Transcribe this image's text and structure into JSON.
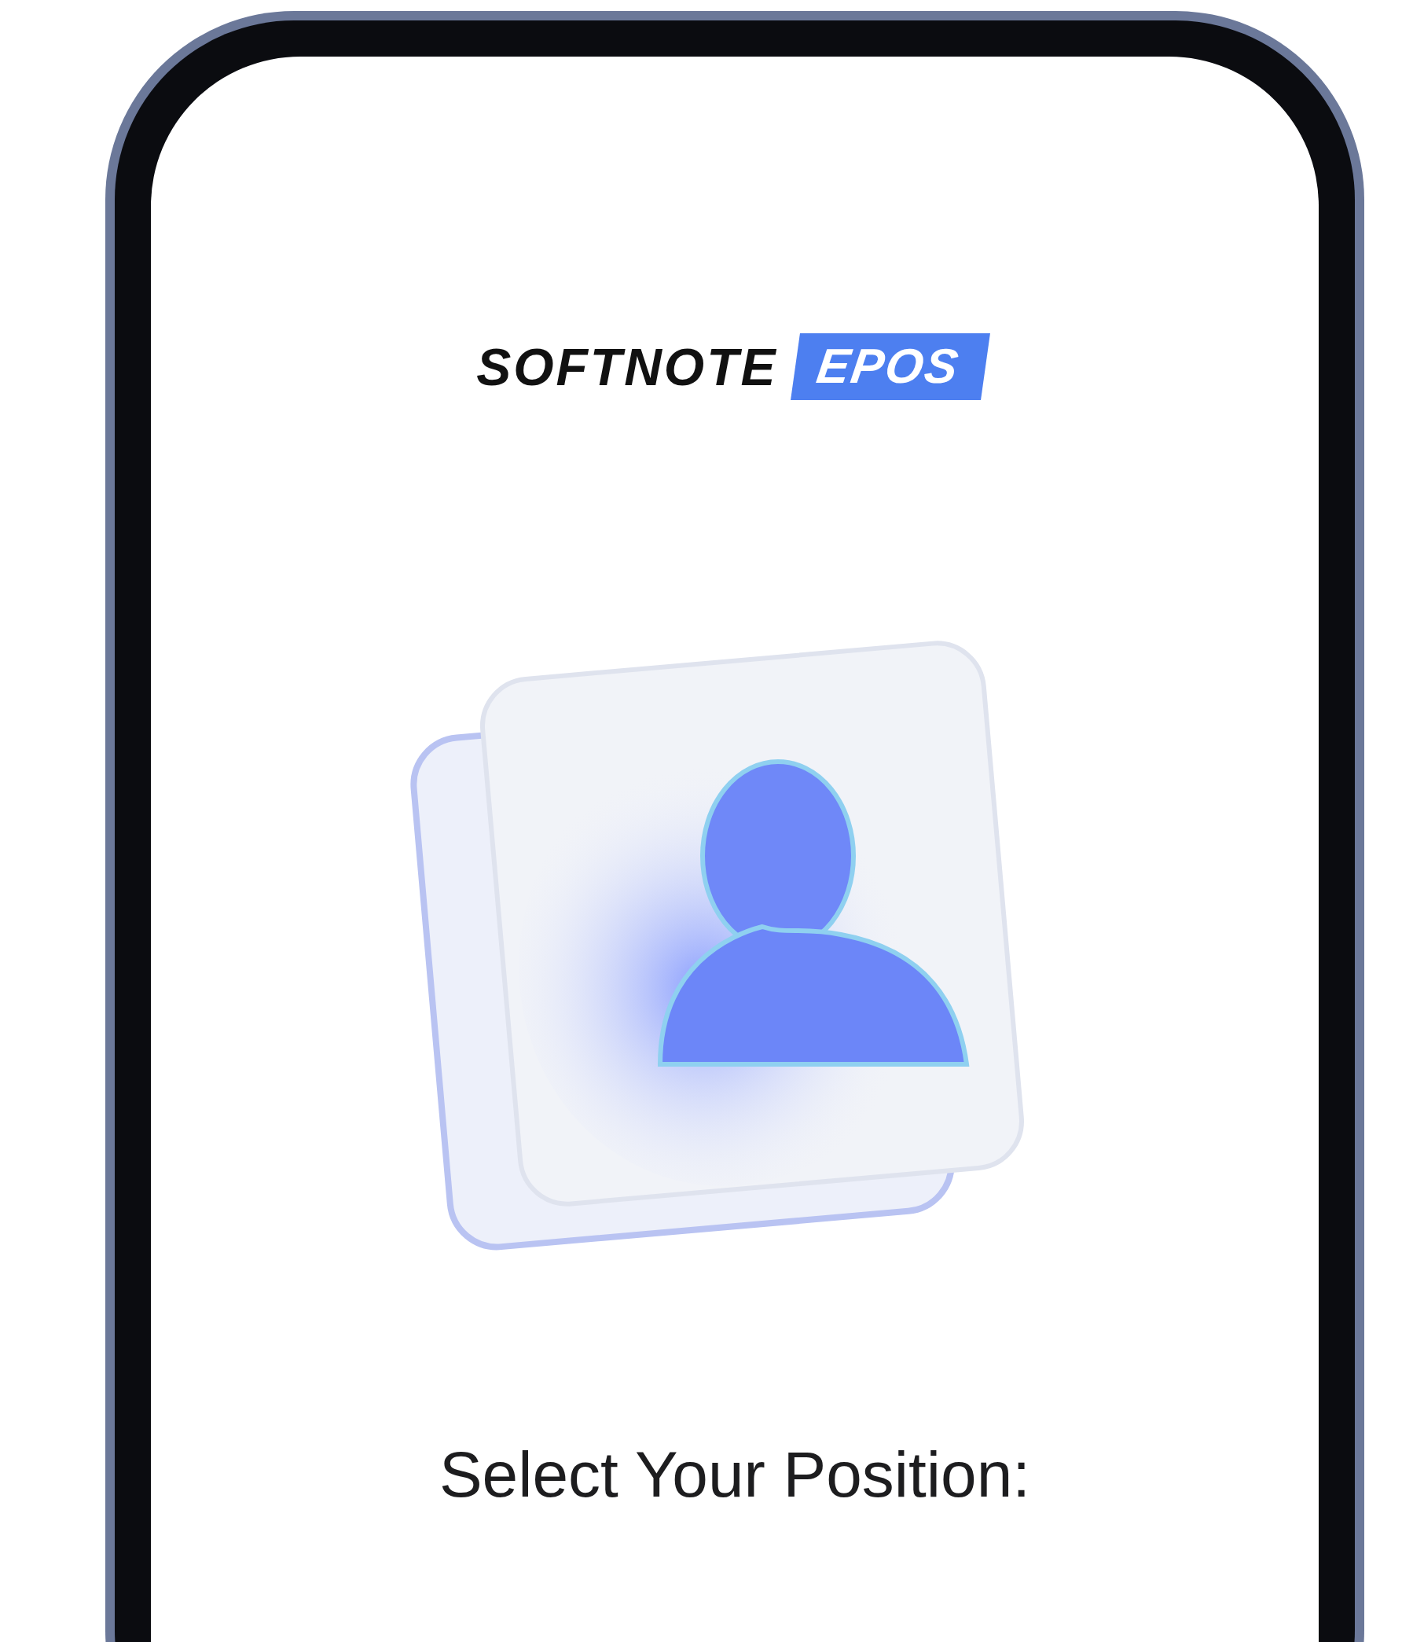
{
  "logo": {
    "brand": "SOFTNOTE",
    "badge": "EPOS"
  },
  "prompt": "Select Your Position:"
}
